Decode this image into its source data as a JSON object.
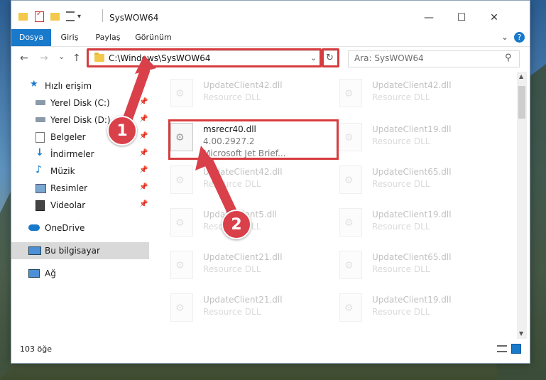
{
  "window": {
    "title": "SysWOW64",
    "quick_access_dropdown": "▾",
    "minimize": "—",
    "maximize": "☐",
    "close": "✕"
  },
  "ribbon": {
    "tabs": [
      {
        "label": "Dosya",
        "active": true
      },
      {
        "label": "Giriş"
      },
      {
        "label": "Paylaş"
      },
      {
        "label": "Görünüm"
      }
    ],
    "collapse": "⌄",
    "help": "?"
  },
  "nav": {
    "back": "←",
    "forward": "→",
    "recent": "⌄",
    "up": "↑",
    "address": "C:\\Windows\\SysWOW64",
    "address_dropdown": "⌄",
    "refresh": "↻",
    "search_placeholder": "Ara: SysWOW64",
    "search_icon": "⚲"
  },
  "sidebar": {
    "items": [
      {
        "label": "Hızlı erişim",
        "icon": "star-icon",
        "pinned": false
      },
      {
        "label": "Yerel Disk (C:)",
        "icon": "drive-icon",
        "pinned": true
      },
      {
        "label": "Yerel Disk (D:)",
        "icon": "drive-icon",
        "pinned": true
      },
      {
        "label": "Belgeler",
        "icon": "documents-icon",
        "pinned": true
      },
      {
        "label": "İndirmeler",
        "icon": "download-icon",
        "pinned": true
      },
      {
        "label": "Müzik",
        "icon": "music-icon",
        "pinned": true
      },
      {
        "label": "Resimler",
        "icon": "pictures-icon",
        "pinned": true
      },
      {
        "label": "Videolar",
        "icon": "videos-icon",
        "pinned": true
      },
      {
        "label": "OneDrive",
        "icon": "cloud-icon",
        "pinned": false
      },
      {
        "label": "Bu bilgisayar",
        "icon": "computer-icon",
        "pinned": false,
        "selected": true
      },
      {
        "label": "Ağ",
        "icon": "network-icon",
        "pinned": false
      }
    ],
    "pin_glyph": "📌"
  },
  "files": {
    "left": [
      {
        "name": "UpdateClient42.dll",
        "type": "Resource DLL",
        "faded": true
      },
      {
        "name": "msrecr40.dll",
        "version": "4.00.2927.2",
        "desc": "Microsoft Jet Brief...",
        "faded": false
      },
      {
        "name": "UpdateClient42.dll",
        "type": "Resource DLL",
        "faded": true
      },
      {
        "name": "UpdateClient5.dll",
        "type": "Resource DLL",
        "faded": true
      },
      {
        "name": "UpdateClient21.dll",
        "type": "Resource DLL",
        "faded": true
      },
      {
        "name": "UpdateClient21.dll",
        "type": "Resource DLL",
        "faded": true
      }
    ],
    "right": [
      {
        "name": "UpdateClient42.dll",
        "type": "Resource DLL"
      },
      {
        "name": "UpdateClient19.dll",
        "type": "Resource DLL"
      },
      {
        "name": "UpdateClient65.dll",
        "type": "Resource DLL"
      },
      {
        "name": "UpdateClient19.dll",
        "type": "Resource DLL"
      },
      {
        "name": "UpdateClient65.dll",
        "type": "Resource DLL"
      },
      {
        "name": "UpdateClient19.dll",
        "type": "Resource DLL"
      }
    ]
  },
  "status": {
    "count": "103 öğe"
  },
  "annotations": {
    "step1": "1",
    "step2": "2",
    "color": "#d9404a"
  }
}
